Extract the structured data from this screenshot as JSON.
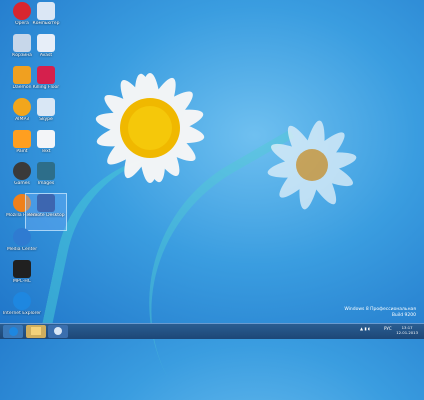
{
  "desktop": {
    "icons": [
      {
        "label": "Opera",
        "color": "#d8262f",
        "icon": "opera-icon"
      },
      {
        "label": "Компьютер",
        "color": "#dbe7f5",
        "icon": "computer-icon"
      },
      {
        "label": "Корзина",
        "color": "#c7d7ea",
        "icon": "recycle-bin-icon"
      },
      {
        "label": "Avast",
        "color": "#e7eef8",
        "icon": "avast-icon"
      },
      {
        "label": "Daemon",
        "color": "#f0a020",
        "icon": "daemon-tools-icon"
      },
      {
        "label": "Killing Floor",
        "color": "#d5204d",
        "icon": "game-icon"
      },
      {
        "label": "AIMP3",
        "color": "#f2a61c",
        "icon": "aimp-icon"
      },
      {
        "label": "Skype",
        "color": "#d9e7f5",
        "icon": "skype-icon"
      },
      {
        "label": "Paint",
        "color": "#ff9f20",
        "icon": "paint-icon"
      },
      {
        "label": "Text",
        "color": "#f3f5f8",
        "icon": "text-file-icon"
      },
      {
        "label": "Games",
        "color": "#3a3a3a",
        "icon": "games-icon"
      },
      {
        "label": "Images",
        "color": "#2d6e8a",
        "icon": "image-icon"
      },
      {
        "label": "Mozilla Firefox",
        "color": "#f0801a",
        "icon": "firefox-icon"
      },
      {
        "label": "Remote Desktop",
        "color": "#3d66b0",
        "icon": "remote-desktop-icon"
      },
      {
        "label": "Media Center",
        "color": "#2f7bd1",
        "icon": "media-icon"
      },
      {
        "label": "MPC-HC",
        "color": "#202020",
        "icon": "video-player-icon"
      },
      {
        "label": "Internet Explorer",
        "color": "#1e87e0",
        "icon": "ie-icon"
      }
    ]
  },
  "watermark": {
    "line1": "Windows 8 Профессиональная",
    "line2": "Build 9200"
  },
  "taskbar": {
    "lang": "РУС",
    "time": "13:17",
    "date": "12.01.2013"
  }
}
